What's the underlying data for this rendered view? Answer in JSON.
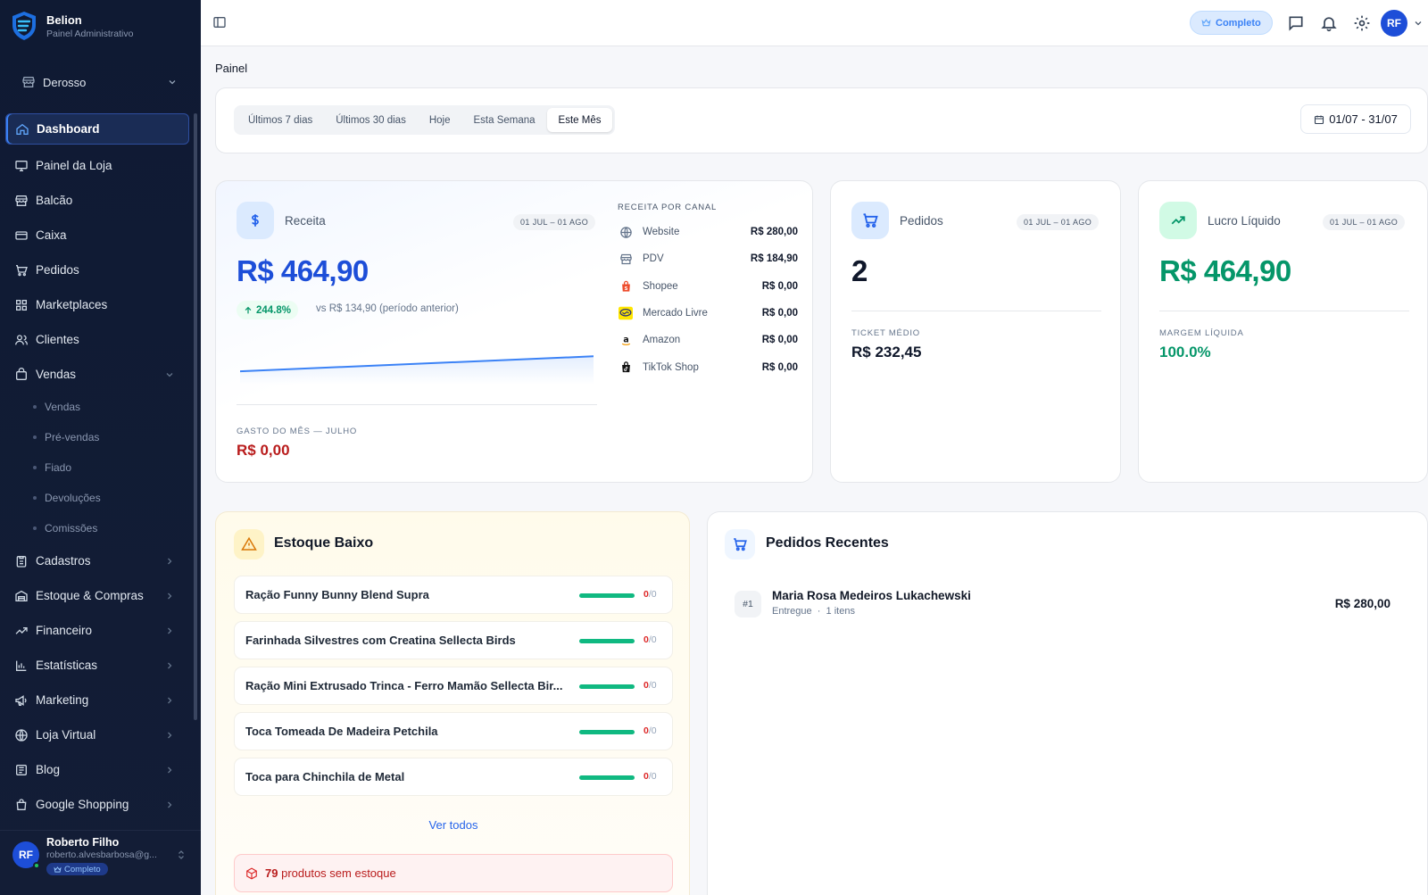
{
  "brand": {
    "name": "Belion",
    "subtitle": "Painel Administrativo"
  },
  "store_selector": {
    "label": "Derosso"
  },
  "sidebar": {
    "items": [
      {
        "label": "Dashboard",
        "icon": "home-icon",
        "active": true
      },
      {
        "label": "Painel da Loja",
        "icon": "monitor-icon"
      },
      {
        "label": "Balcão",
        "icon": "store-icon"
      },
      {
        "label": "Caixa",
        "icon": "wallet-icon"
      },
      {
        "label": "Pedidos",
        "icon": "cart-icon"
      },
      {
        "label": "Marketplaces",
        "icon": "grid-icon"
      },
      {
        "label": "Clientes",
        "icon": "users-icon"
      },
      {
        "label": "Vendas",
        "icon": "bag-icon",
        "expanded": true
      }
    ],
    "vendas_sub": [
      "Vendas",
      "Pré-vendas",
      "Fiado",
      "Devoluções",
      "Comissões"
    ],
    "items_after": [
      {
        "label": "Cadastros",
        "icon": "clipboard-icon"
      },
      {
        "label": "Estoque & Compras",
        "icon": "warehouse-icon"
      },
      {
        "label": "Financeiro",
        "icon": "trending-up-icon"
      },
      {
        "label": "Estatísticas",
        "icon": "bar-chart-icon"
      },
      {
        "label": "Marketing",
        "icon": "megaphone-icon"
      },
      {
        "label": "Loja Virtual",
        "icon": "globe-icon"
      },
      {
        "label": "Blog",
        "icon": "newspaper-icon"
      },
      {
        "label": "Google Shopping",
        "icon": "shopping-bag-icon"
      }
    ]
  },
  "user": {
    "initials": "RF",
    "name": "Roberto Filho",
    "email": "roberto.alvesbarbosa@g...",
    "plan": "Completo"
  },
  "topbar": {
    "plan": "Completo",
    "avatar": "RF"
  },
  "breadcrumb": "Painel",
  "filters": {
    "tabs": [
      "Últimos 7 dias",
      "Últimos 30 dias",
      "Hoje",
      "Esta Semana",
      "Este Mês"
    ],
    "active": "Este Mês",
    "date_range": "01/07 - 31/07"
  },
  "revenue": {
    "title": "Receita",
    "period": "01 JUL – 01 AGO",
    "value": "R$ 464,90",
    "growth": "244.8%",
    "comparison": "vs R$ 134,90 (período anterior)",
    "spent_label": "GASTO DO MÊS — JULHO",
    "spent_value": "R$ 0,00",
    "channels_title": "RECEITA POR CANAL",
    "channels": [
      {
        "name": "Website",
        "value": "R$ 280,00",
        "icon": "globe-icon"
      },
      {
        "name": "PDV",
        "value": "R$ 184,90",
        "icon": "store-icon"
      },
      {
        "name": "Shopee",
        "value": "R$ 0,00",
        "icon": "shopee-icon"
      },
      {
        "name": "Mercado Livre",
        "value": "R$ 0,00",
        "icon": "mercado-livre-icon"
      },
      {
        "name": "Amazon",
        "value": "R$ 0,00",
        "icon": "amazon-icon"
      },
      {
        "name": "TikTok Shop",
        "value": "R$ 0,00",
        "icon": "tiktok-icon"
      }
    ],
    "trend": [
      134.9,
      464.9
    ]
  },
  "orders": {
    "title": "Pedidos",
    "period": "01 JUL – 01 AGO",
    "value": "2",
    "ticket_label": "TICKET MÉDIO",
    "ticket_value": "R$ 232,45"
  },
  "profit": {
    "title": "Lucro Líquido",
    "period": "01 JUL – 01 AGO",
    "value": "R$ 464,90",
    "margin_label": "MARGEM LÍQUIDA",
    "margin_value": "100.0%"
  },
  "low_stock": {
    "title": "Estoque Baixo",
    "items": [
      {
        "name": "Ração Funny Bunny Blend Supra",
        "qty": "0",
        "min": "0"
      },
      {
        "name": "Farinhada Silvestres com Creatina Sellecta Birds",
        "qty": "0",
        "min": "0"
      },
      {
        "name": "Ração Mini Extrusado Trinca - Ferro Mamão Sellecta Bir...",
        "qty": "0",
        "min": "0"
      },
      {
        "name": "Toca Tomeada De Madeira Petchila",
        "qty": "0",
        "min": "0"
      },
      {
        "name": "Toca para Chinchila de Metal",
        "qty": "0",
        "min": "0"
      }
    ],
    "see_all": "Ver todos",
    "out_count": "79",
    "out_text": "produtos sem estoque"
  },
  "recent_orders": {
    "title": "Pedidos Recentes",
    "items": [
      {
        "num": "#1",
        "customer": "Maria Rosa Medeiros Lukachewski",
        "status": "Entregue",
        "items": "1 itens",
        "amount": "R$ 280,00"
      }
    ]
  },
  "colors": {
    "sidebar_bg": "#0f1a33",
    "accent": "#1d4ed8",
    "revenue": "#1d4ed8",
    "profit": "#059669",
    "danger": "#dc2626",
    "stock_bar": "#10b981"
  }
}
